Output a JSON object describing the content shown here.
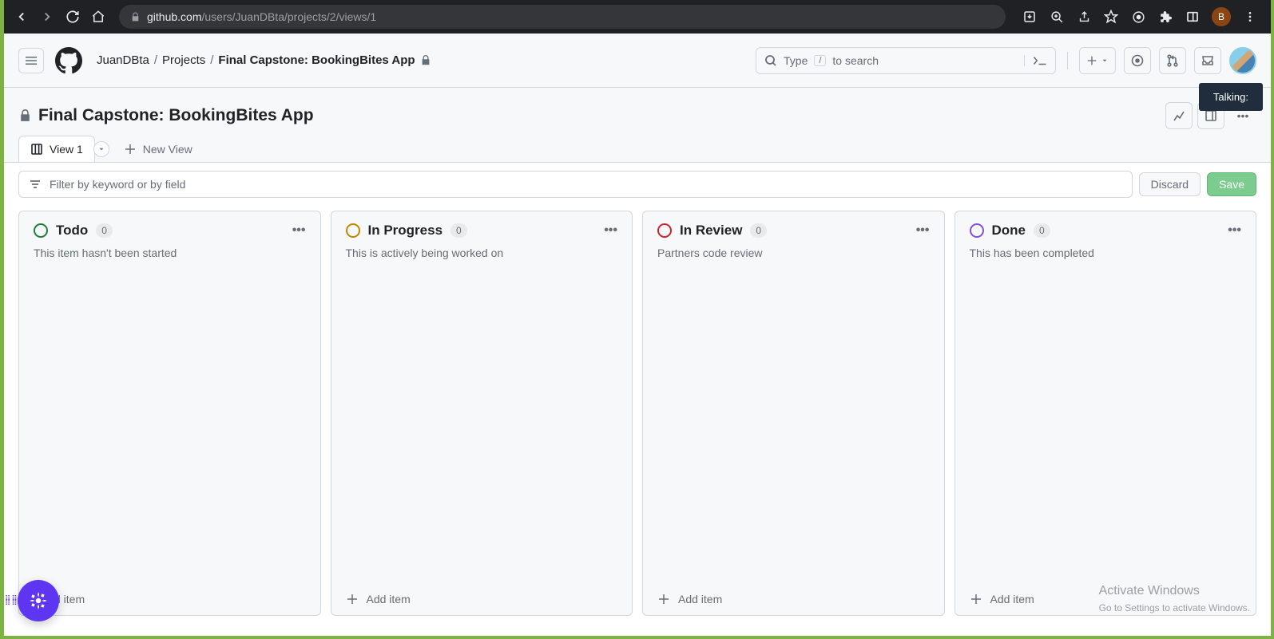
{
  "browser": {
    "url_host": "github.com",
    "url_path": "/users/JuanDBta/projects/2/views/1",
    "profile_initial": "B"
  },
  "header": {
    "breadcrumb_user": "JuanDBta",
    "breadcrumb_projects": "Projects",
    "breadcrumb_current": "Final Capstone: BookingBites App",
    "search_pretext": "Type",
    "search_slash": "/",
    "search_posttext": "to search"
  },
  "tooltip_text": "Talking:",
  "project": {
    "title": "Final Capstone: BookingBites App"
  },
  "tabs": {
    "active": "View 1",
    "new_view": "New View"
  },
  "filter": {
    "placeholder": "Filter by keyword or by field",
    "discard": "Discard",
    "save": "Save"
  },
  "columns": [
    {
      "title": "Todo",
      "count": "0",
      "desc": "This item hasn't been started",
      "dot": "dot-green",
      "add": "d item"
    },
    {
      "title": "In Progress",
      "count": "0",
      "desc": "This is actively being worked on",
      "dot": "dot-yellow",
      "add": "Add item"
    },
    {
      "title": "In Review",
      "count": "0",
      "desc": "Partners code review",
      "dot": "dot-red",
      "add": "Add item"
    },
    {
      "title": "Done",
      "count": "0",
      "desc": "This has been completed",
      "dot": "dot-purple",
      "add": "Add item"
    }
  ],
  "watermark": {
    "line1": "Activate Windows",
    "line2": "Go to Settings to activate Windows."
  }
}
